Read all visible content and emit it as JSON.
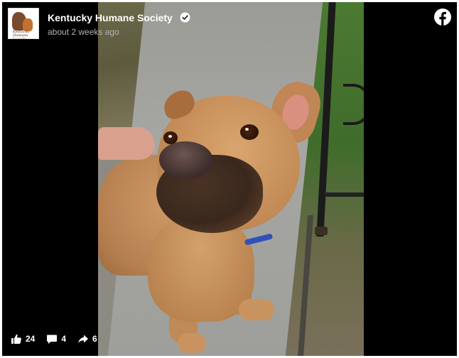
{
  "post": {
    "page_name": "Kentucky Humane Society",
    "timestamp": "about 2 weeks ago",
    "verified_icon": "verified-badge-icon",
    "avatar_text": "Kentucky Humane Society"
  },
  "branding": {
    "platform_icon": "facebook-icon",
    "accent_color": "#1877f2"
  },
  "media": {
    "type": "photo",
    "subject": "tan dog with blue collar on sidewalk"
  },
  "stats": {
    "likes": "24",
    "comments": "4",
    "shares": "6",
    "like_icon": "thumbs-up-icon",
    "comment_icon": "comment-icon",
    "share_icon": "share-arrow-icon"
  }
}
